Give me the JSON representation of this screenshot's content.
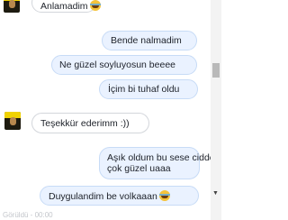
{
  "messages": {
    "m0": {
      "text": "Anlamadim",
      "emoji": "laughing-tears"
    },
    "m1": {
      "text": "Bende nalmadim"
    },
    "m2": {
      "text": "Ne güzel soyluyosun beeee"
    },
    "m3": {
      "text": "İçim bi tuhaf oldu"
    },
    "m4": {
      "text": "Teşekkür ederimm :))"
    },
    "m5": {
      "line1": "Aşık oldum bu sese cidden",
      "line2": "çok güzel uaaa"
    },
    "m6": {
      "text": "Duygulandim be volkaaan",
      "emoji": "laughing-tears"
    }
  },
  "footer": {
    "text": "Görüldü - 00:00"
  },
  "colors": {
    "outgoing_bubble": "#eaf2ff",
    "incoming_bubble": "#ffffff",
    "border": "#d3d6db"
  }
}
